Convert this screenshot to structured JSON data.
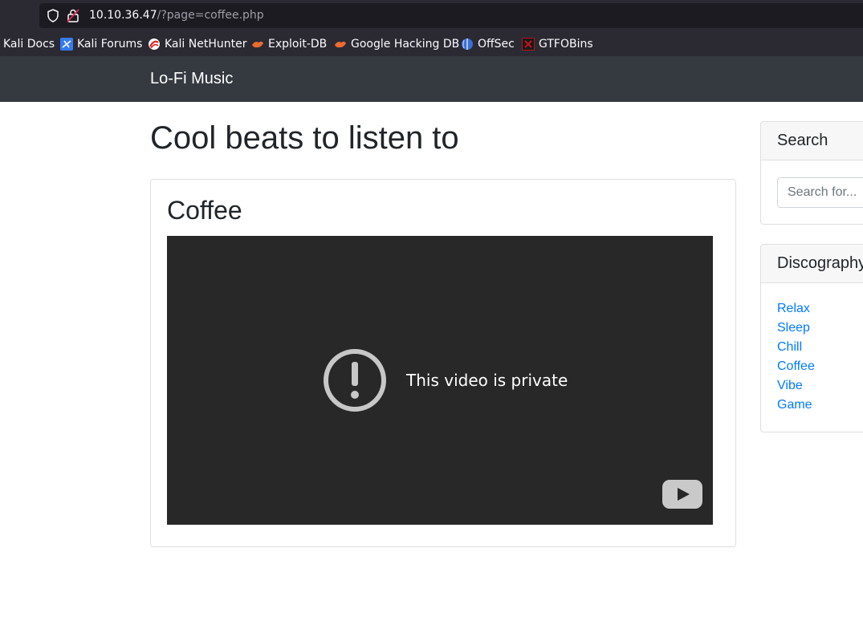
{
  "browser": {
    "url_host": "10.10.36.47",
    "url_path": "/?page=coffee.php",
    "bookmarks": [
      {
        "label": "Kali Docs",
        "icon": "kali-docs-icon"
      },
      {
        "label": "Kali Forums",
        "icon": "kali-forums-icon"
      },
      {
        "label": "Kali NetHunter",
        "icon": "kali-nethunter-icon"
      },
      {
        "label": "Exploit-DB",
        "icon": "exploit-db-icon"
      },
      {
        "label": "Google Hacking DB",
        "icon": "google-hacking-db-icon"
      },
      {
        "label": "OffSec",
        "icon": "offsec-icon"
      },
      {
        "label": "GTFOBins",
        "icon": "gtfobins-icon"
      }
    ]
  },
  "site": {
    "brand": "Lo-Fi Music",
    "title": "Cool beats to listen to",
    "card_title": "Coffee",
    "video_message": "This video is private"
  },
  "sidebar": {
    "search": {
      "heading": "Search",
      "placeholder": "Search for..."
    },
    "discography": {
      "heading": "Discography",
      "items": [
        "Relax",
        "Sleep",
        "Chill",
        "Coffee",
        "Vibe",
        "Game"
      ]
    }
  },
  "colors": {
    "navbar": "#343a40",
    "link": "#007bff",
    "video_bg": "#282828"
  }
}
